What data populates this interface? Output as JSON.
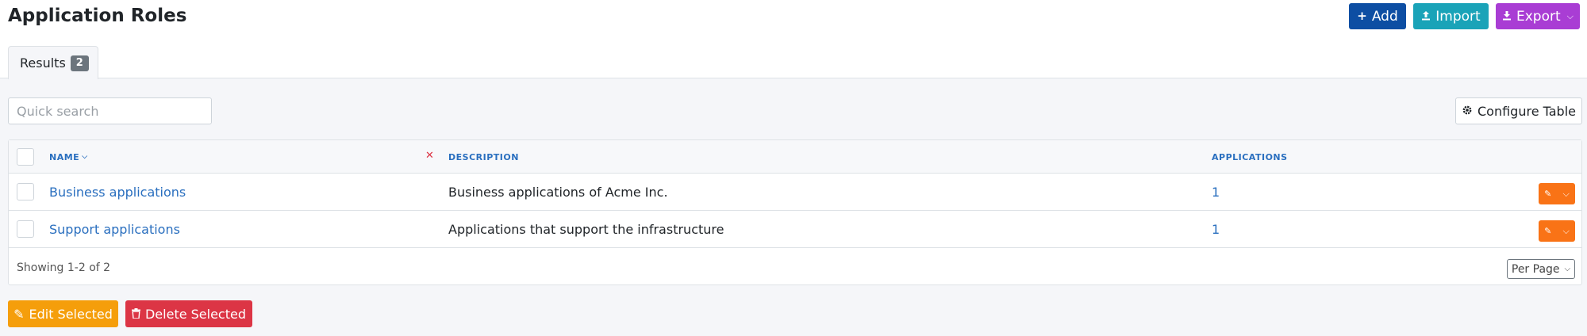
{
  "page": {
    "title": "Application Roles"
  },
  "header_buttons": {
    "add": {
      "icon": "plus-icon",
      "label": "Add"
    },
    "import": {
      "icon": "upload-icon",
      "label": "Import"
    },
    "export": {
      "icon": "download-icon",
      "label": "Export"
    }
  },
  "tabs": [
    {
      "label": "Results",
      "count": "2"
    }
  ],
  "search": {
    "placeholder": "Quick search",
    "value": ""
  },
  "configure_table": {
    "icon": "gear-icon",
    "label": "Configure Table"
  },
  "table": {
    "columns": {
      "name": "NAME",
      "description": "DESCRIPTION",
      "applications": "APPLICATIONS"
    },
    "sort": {
      "column": "name",
      "direction": "desc"
    },
    "rows": [
      {
        "name": "Business applications",
        "description": "Business applications of Acme Inc.",
        "applications": "1"
      },
      {
        "name": "Support applications",
        "description": "Applications that support the infrastructure",
        "applications": "1"
      }
    ],
    "showing": "Showing 1-2 of 2",
    "per_page": "Per Page"
  },
  "footer_buttons": {
    "edit_selected": "Edit Selected",
    "delete_selected": "Delete Selected"
  },
  "colors": {
    "add": "#0d4ea3",
    "import": "#1aa3b8",
    "export": "#a93dd4",
    "row_action": "#f97316",
    "edit_selected": "#f59e0b",
    "delete_selected": "#dc3545",
    "link": "#2a6fbf"
  }
}
